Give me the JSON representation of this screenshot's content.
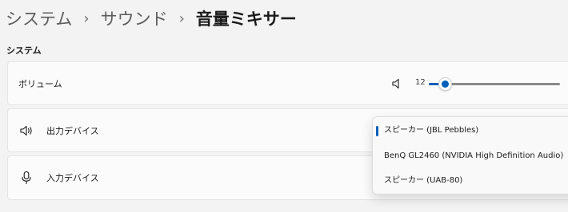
{
  "breadcrumb": {
    "items": [
      "システム",
      "サウンド"
    ],
    "separator": "›",
    "current": "音量ミキサー"
  },
  "section": {
    "heading": "システム"
  },
  "volume": {
    "label": "ボリューム",
    "icon": "speaker-icon",
    "value": "12",
    "level_percent": 12
  },
  "output": {
    "label": "出力デバイス",
    "icon": "speaker-wave-icon"
  },
  "input": {
    "label": "入力デバイス",
    "icon": "microphone-icon"
  },
  "dropdown": {
    "options": [
      "スピーカー (JBL Pebbles)",
      "BenQ GL2460 (NVIDIA High Definition Audio)",
      "スピーカー (UAB-80)"
    ],
    "selected_index": 0
  },
  "colors": {
    "accent": "#005fb8",
    "background": "#f3f3f3",
    "card": "#fbfbfb"
  }
}
